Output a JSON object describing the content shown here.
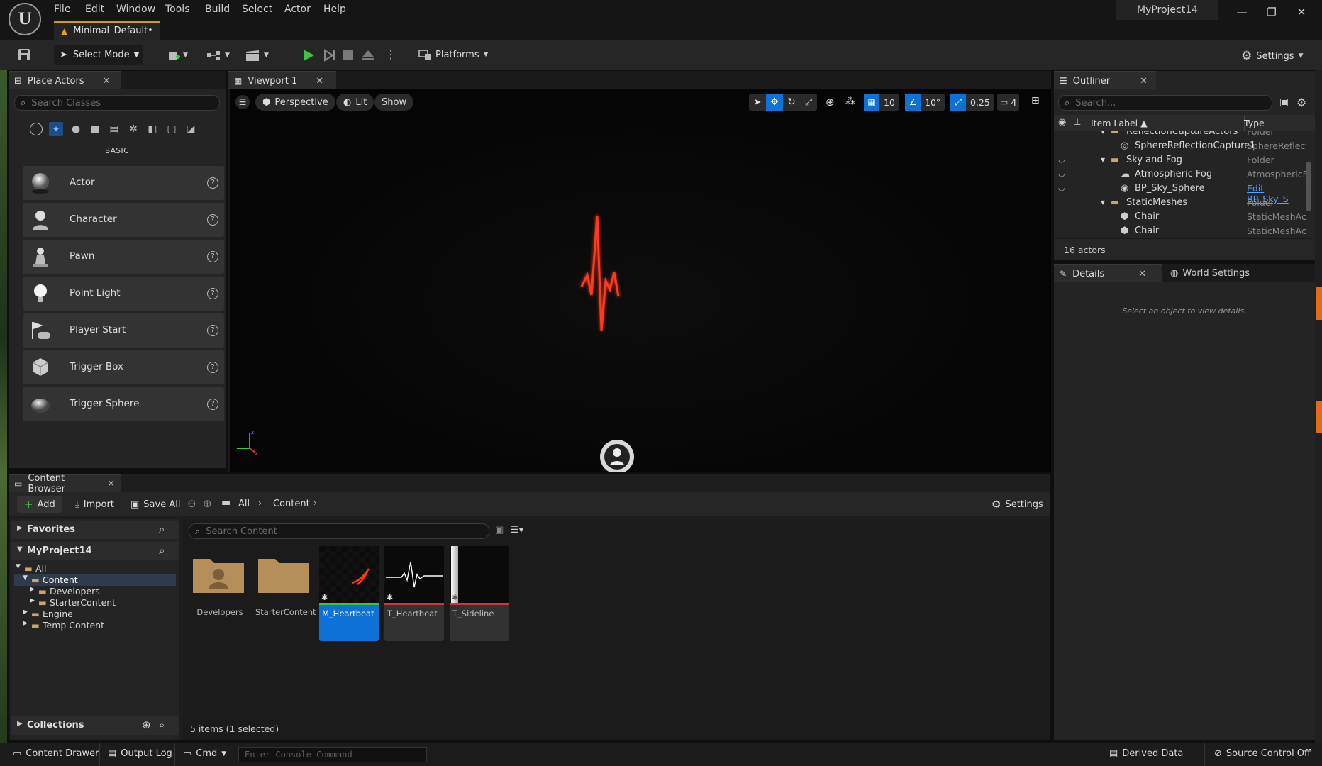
{
  "app": {
    "menu": [
      "File",
      "Edit",
      "Window",
      "Tools",
      "Build",
      "Select",
      "Actor",
      "Help"
    ],
    "doc_tab": "Minimal_Default•",
    "project_name": "MyProject14",
    "window_controls": [
      "—",
      "❐",
      "✕"
    ]
  },
  "toolbar": {
    "select_mode": "Select Mode",
    "platforms": "Platforms",
    "settings": "Settings"
  },
  "place_actors": {
    "tab": "Place Actors",
    "search_placeholder": "Search Classes",
    "category": "BASIC",
    "items": [
      {
        "label": "Actor",
        "icon": "sphere-icon"
      },
      {
        "label": "Character",
        "icon": "character-icon"
      },
      {
        "label": "Pawn",
        "icon": "pawn-icon"
      },
      {
        "label": "Point Light",
        "icon": "light-bulb-icon"
      },
      {
        "label": "Player Start",
        "icon": "player-start-icon"
      },
      {
        "label": "Trigger Box",
        "icon": "cube-icon"
      },
      {
        "label": "Trigger Sphere",
        "icon": "sphere-icon"
      }
    ]
  },
  "viewport": {
    "tab": "Viewport 1",
    "perspective": "Perspective",
    "lit": "Lit",
    "show": "Show",
    "grid_snap": "10",
    "rotation_snap": "10°",
    "scale_snap": "0.25",
    "camera_speed": "4"
  },
  "outliner": {
    "tab": "Outliner",
    "search_placeholder": "Search...",
    "col_label": "Item Label ▲",
    "col_type": "Type",
    "rows": [
      {
        "label": "ReflectionCaptureActors",
        "type": "Folder",
        "indent": 1,
        "kind": "folder"
      },
      {
        "label": "SphereReflectionCapture1",
        "type": "SphereReflect",
        "indent": 2,
        "kind": "actor"
      },
      {
        "label": "Sky and Fog",
        "type": "Folder",
        "indent": 1,
        "kind": "folder"
      },
      {
        "label": "Atmospheric Fog",
        "type": "AtmosphericF",
        "indent": 2,
        "kind": "actor"
      },
      {
        "label": "BP_Sky_Sphere",
        "type": "Edit BP_Sky_S",
        "indent": 2,
        "kind": "actor"
      },
      {
        "label": "StaticMeshes",
        "type": "Folder",
        "indent": 1,
        "kind": "folder"
      },
      {
        "label": "Chair",
        "type": "StaticMeshAc",
        "indent": 2,
        "kind": "actor"
      },
      {
        "label": "Chair",
        "type": "StaticMeshAc",
        "indent": 2,
        "kind": "actor"
      }
    ],
    "count": "16 actors"
  },
  "details": {
    "tab": "Details",
    "world_tab": "World Settings",
    "empty_msg": "Select an object to view details."
  },
  "content_browser": {
    "tab": "Content Browser",
    "add": "Add",
    "import": "Import",
    "save_all": "Save All",
    "path": [
      "All",
      "Content"
    ],
    "settings": "Settings",
    "favorites": "Favorites",
    "project": "MyProject14",
    "collections": "Collections",
    "search_placeholder": "Search Content",
    "tree": [
      {
        "label": "All",
        "indent": 0
      },
      {
        "label": "Content",
        "indent": 1
      },
      {
        "label": "Developers",
        "indent": 2
      },
      {
        "label": "StarterContent",
        "indent": 2
      },
      {
        "label": "Engine",
        "indent": 1
      },
      {
        "label": "Temp Content",
        "indent": 1
      }
    ],
    "assets": [
      {
        "name": "Developers",
        "kind": "folder"
      },
      {
        "name": "StarterContent",
        "kind": "folder"
      },
      {
        "name": "M_Heartbeat",
        "kind": "material"
      },
      {
        "name": "T_Heartbeat",
        "kind": "texture"
      },
      {
        "name": "T_Sideline",
        "kind": "texture"
      }
    ],
    "status": "5 items (1 selected)"
  },
  "statusbar": {
    "content_drawer": "Content Drawer",
    "output_log": "Output Log",
    "cmd": "Cmd",
    "console_placeholder": "Enter Console Command",
    "derived_data": "Derived Data",
    "source_control": "Source Control Off"
  },
  "colors": {
    "accent_blue": "#0e71d6",
    "play_green": "#3ec53e",
    "heartbeat_red": "#ff3a1c"
  }
}
